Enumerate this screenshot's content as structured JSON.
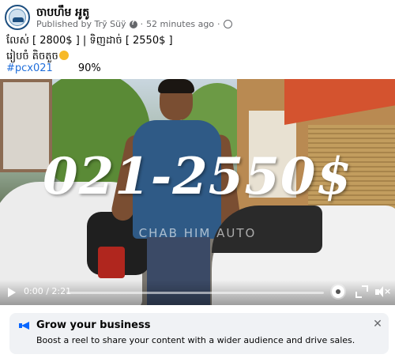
{
  "page": {
    "name": "ចាបហឹម អូតូ",
    "published_by_label": "Published by",
    "publisher": "Trỹ Süÿ",
    "timestamp": "52 minutes ago"
  },
  "post": {
    "line1": "លែស់  [ 2800$ ]   | ទិញដាច់   [ 2550$ ]",
    "line2": "រៀបចំ តិចតួច",
    "hashtag": "#pcx021",
    "percent": "90%"
  },
  "video": {
    "overlay_price": "021-2550$",
    "watermark": "CHAB HIM AUTO",
    "time": "0:00 / 2:21",
    "progress": 0
  },
  "promo": {
    "title": "Grow your business",
    "text": "Boost a reel to share your content with a wider audience and drive sales."
  },
  "colors": {
    "link": "#216fdb",
    "accent": "#0866ff",
    "secondary_text": "#65676b"
  }
}
